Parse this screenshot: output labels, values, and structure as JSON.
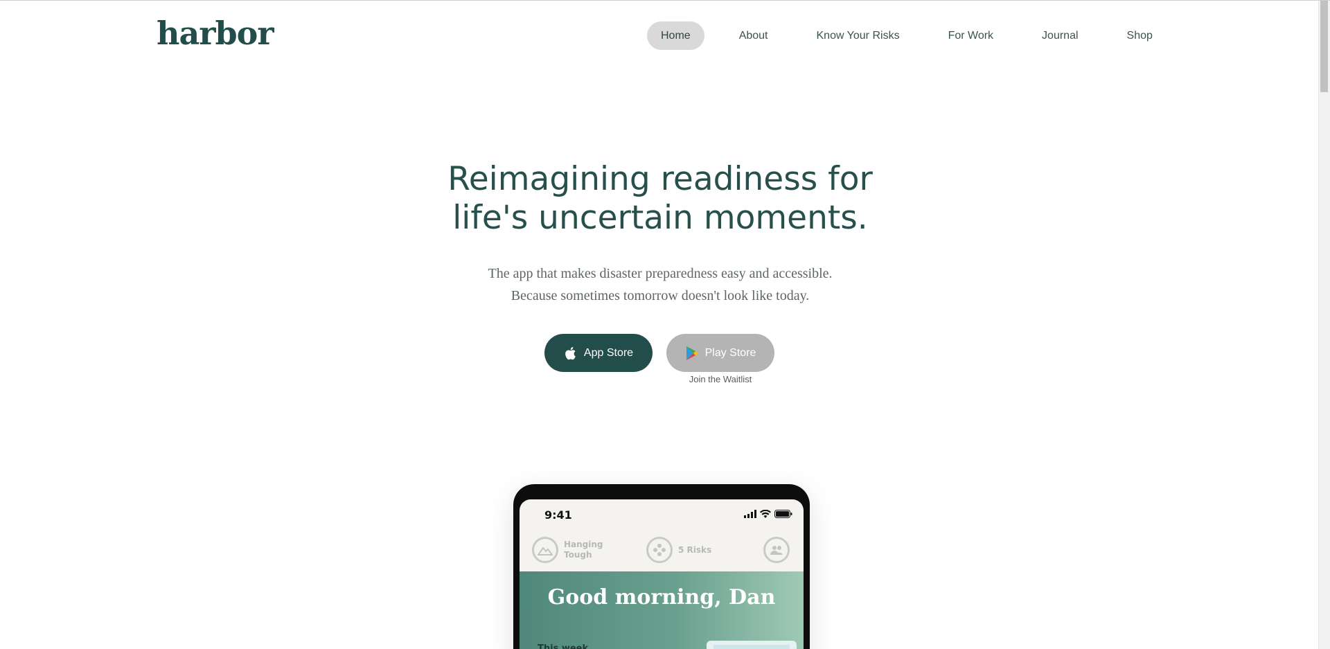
{
  "header": {
    "logo": "harbor",
    "nav": [
      {
        "label": "Home",
        "active": true
      },
      {
        "label": "About",
        "active": false
      },
      {
        "label": "Know Your Risks",
        "active": false
      },
      {
        "label": "For Work",
        "active": false
      },
      {
        "label": "Journal",
        "active": false
      },
      {
        "label": "Shop",
        "active": false
      }
    ]
  },
  "hero": {
    "title_line1": "Reimagining readiness for",
    "title_line2": "life's uncertain moments.",
    "sub_line1": "The app that makes disaster preparedness easy and accessible.",
    "sub_line2": "Because sometimes tomorrow doesn't look like today."
  },
  "buttons": {
    "app_store": "App Store",
    "play_store": "Play Store",
    "waitlist": "Join the Waitlist"
  },
  "phone": {
    "time": "9:41",
    "status_line1": "Hanging",
    "status_line2": "Tough",
    "risks": "5 Risks",
    "greeting": "Good morning, Dan",
    "this_week": "This week"
  },
  "colors": {
    "brand": "#234d4a",
    "nav_active_bg": "#d9d9d9",
    "play_button_bg": "#b4b4b4"
  },
  "icons": {
    "app_store": "apple-icon",
    "play_store": "google-play-icon",
    "status": [
      "signal-icon",
      "wifi-icon",
      "battery-icon"
    ],
    "header": [
      "mountain-icon",
      "risks-icon",
      "people-icon"
    ]
  }
}
